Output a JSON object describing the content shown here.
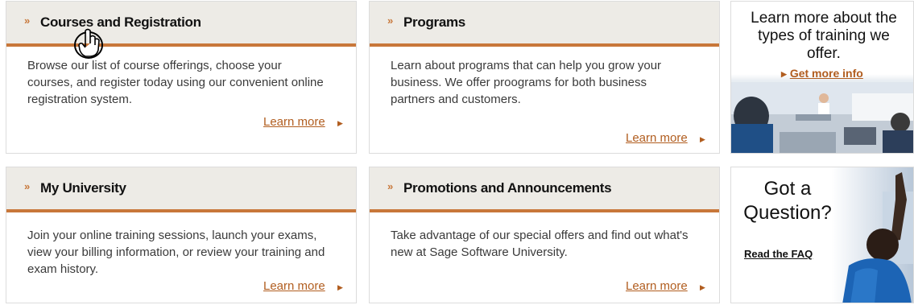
{
  "cards": [
    {
      "title": "Courses and Registration",
      "body": "Browse our list of course offerings, choose your courses, and register today using our convenient online registration system.",
      "link": "Learn more"
    },
    {
      "title": "Programs",
      "body": "Learn about programs that can help you grow your business. We offer proograms for both business partners and customers.",
      "link": "Learn more"
    },
    {
      "title": "My University",
      "body": "Join your online training sessions, launch your exams, view your billing information, or review your training and exam history.",
      "link": "Learn more"
    },
    {
      "title": "Promotions and Announcements",
      "body": "Take advantage of our special offers and find out what's new at Sage Software University.",
      "link": "Learn more"
    }
  ],
  "promos": {
    "training": {
      "heading": "Learn more about the types of training we offer.",
      "link": "Get more info"
    },
    "faq": {
      "heading_line1": "Got a",
      "heading_line2": "Question?",
      "link": "Read the FAQ"
    }
  },
  "colors": {
    "accent": "#c8773a",
    "link": "#b15d1f",
    "header_bg": "#edebe6"
  }
}
